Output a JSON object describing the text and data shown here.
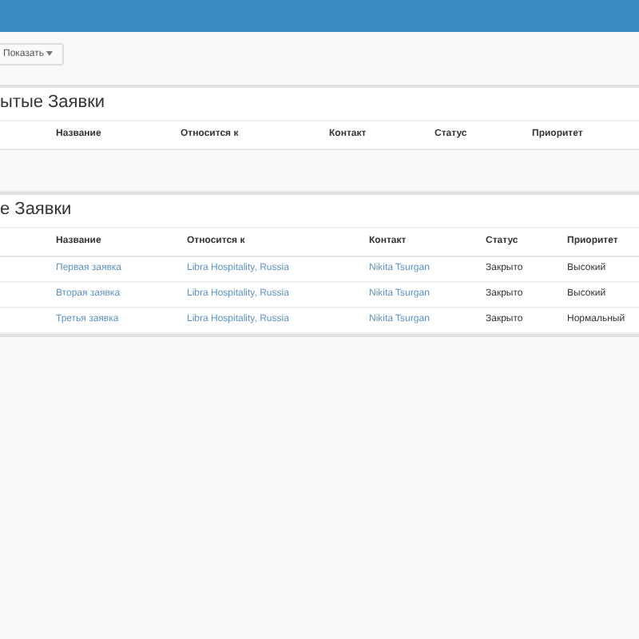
{
  "toolbar": {
    "show_button": "Показать"
  },
  "panels": [
    {
      "title": "ытые Заявки",
      "columns": [
        "Название",
        "Относится к",
        "Контакт",
        "Статус",
        "Приоритет"
      ]
    },
    {
      "title": "е Заявки",
      "columns": [
        "Название",
        "Относится к",
        "Контакт",
        "Статус",
        "Приоритет"
      ],
      "rows": [
        {
          "name": "Первая заявка",
          "relates_to": "Libra Hospitality, Russia",
          "contact": "Nikita Tsurgan",
          "status": "Закрыто",
          "priority": "Высокий"
        },
        {
          "name": "Вторая заявка",
          "relates_to": "Libra Hospitality, Russia",
          "contact": "Nikita Tsurgan",
          "status": "Закрыто",
          "priority": "Высокий"
        },
        {
          "name": "Третья заявка",
          "relates_to": "Libra Hospitality, Russia",
          "contact": "Nikita Tsurgan",
          "status": "Закрыто",
          "priority": "Нормальный"
        }
      ]
    }
  ]
}
